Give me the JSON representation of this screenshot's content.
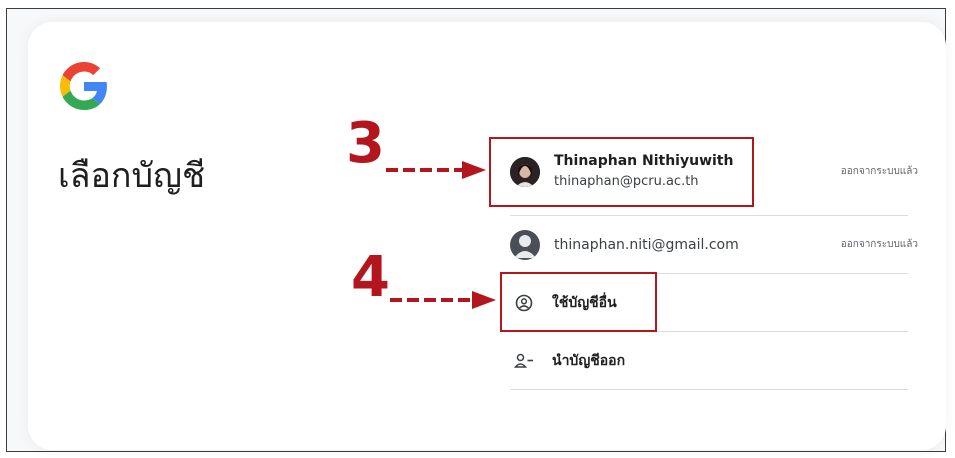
{
  "page": {
    "title": "เลือกบัญชี"
  },
  "accounts": [
    {
      "name": "Thinaphan Nithiyuwith",
      "email": "thinaphan@pcru.ac.th",
      "status": "ออกจากระบบแล้ว",
      "avatar": "profile-photo"
    },
    {
      "name": "",
      "email": "thinaphan.niti@gmail.com",
      "status": "ออกจากระบบแล้ว",
      "avatar": "default-person-icon"
    }
  ],
  "actions": {
    "use_another_label": "ใช้บัญชีอื่น",
    "use_another_icon": "account-circle-icon",
    "remove_label": "นำบัญชีออก",
    "remove_icon": "person-remove-icon"
  },
  "annotations": {
    "step3": "3",
    "step4": "4"
  },
  "colors": {
    "annotation_red": "#b3161c",
    "google_blue": "#4285F4",
    "google_red": "#EA4335",
    "google_yellow": "#FBBC05",
    "google_green": "#34A853"
  }
}
